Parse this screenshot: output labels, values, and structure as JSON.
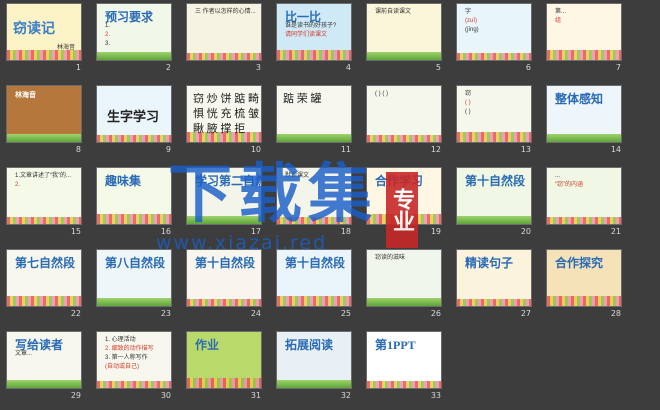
{
  "grid": {
    "background": "#3d3d3d",
    "slides": [
      {
        "n": "1",
        "bg": "#fbf2c6",
        "title": "窃读记",
        "sub": "林海音"
      },
      {
        "n": "2",
        "bg": "#f1f7e9",
        "title": "预习要求",
        "lines": [
          "1.",
          "2.",
          "3."
        ]
      },
      {
        "n": "3",
        "bg": "#f6f3e2",
        "lines": [
          "三 作者以怎样的心情..."
        ]
      },
      {
        "n": "4",
        "bg": "#cfe9f6",
        "title": "比一比",
        "lines": [
          "谁是读书的好孩子?",
          "请同学们读课文"
        ]
      },
      {
        "n": "5",
        "bg": "#fbf6da",
        "lines": [
          "课前自读课文"
        ]
      },
      {
        "n": "6",
        "bg": "#e8f5fb",
        "lines": [
          "字",
          "(zuī)",
          "(jīng)"
        ]
      },
      {
        "n": "7",
        "bg": "#fff7e6",
        "lines": [
          "第...",
          "组"
        ]
      },
      {
        "n": "8",
        "bg": "#b5773c",
        "title": "林海音"
      },
      {
        "n": "9",
        "bg": "#eaf6fb",
        "title": "生字学习"
      },
      {
        "n": "10",
        "bg": "#f7f7ef",
        "lines": [
          "窃 炒 饼 踮 畸",
          "惧 恍 充 梳 皱",
          "瞅 腋 撑 拒"
        ]
      },
      {
        "n": "11",
        "bg": "#f7f7ef",
        "lines": [
          "踮 荣 罐"
        ]
      },
      {
        "n": "12",
        "bg": "#f5f7ec",
        "lines": [
          "( ) ( )"
        ]
      },
      {
        "n": "13",
        "bg": "#f5f7ec",
        "lines": [
          "窃",
          "( )",
          "( )"
        ]
      },
      {
        "n": "14",
        "bg": "#eef5fb",
        "title": "整体感知"
      },
      {
        "n": "15",
        "bg": "#f4f9e8",
        "lines": [
          "1.文章讲述了“我”的...",
          "2."
        ]
      },
      {
        "n": "16",
        "bg": "#f4f9e8",
        "title": "趣味集"
      },
      {
        "n": "17",
        "bg": "#f3f5ea",
        "title": "学习第二自然段"
      },
      {
        "n": "18",
        "bg": "#f3f5ea",
        "lines": [
          "默读课文"
        ]
      },
      {
        "n": "19",
        "bg": "#fff6e3",
        "title": "合作学习"
      },
      {
        "n": "20",
        "bg": "#f0f7e5",
        "title": "第十自然段"
      },
      {
        "n": "21",
        "bg": "#f0f7e5",
        "lines": [
          "...",
          "“窃”的内涵"
        ]
      },
      {
        "n": "22",
        "bg": "#f7f7ef",
        "title": "第七自然段"
      },
      {
        "n": "23",
        "bg": "#eef6f8",
        "title": "第八自然段"
      },
      {
        "n": "24",
        "bg": "#f7f5ee",
        "title": "第十自然段"
      },
      {
        "n": "25",
        "bg": "#eaf4fb",
        "title": "第十自然段"
      },
      {
        "n": "26",
        "bg": "#f1f6ec",
        "lines": [
          "窃读的滋味"
        ]
      },
      {
        "n": "27",
        "bg": "#fbf3dc",
        "title": "精读句子"
      },
      {
        "n": "28",
        "bg": "#f5e2b8",
        "title": "合作探究"
      },
      {
        "n": "29",
        "bg": "#f7f7ef",
        "title": "写给读者",
        "lines": [
          "文章..."
        ]
      },
      {
        "n": "30",
        "bg": "#f7f7ef",
        "lines": [
          "1. 心理活动",
          "2. 细致的动作描写",
          "3. 第一人称写作",
          "(自动或自己)"
        ]
      },
      {
        "n": "31",
        "bg": "#b9d96a",
        "title": "作业"
      },
      {
        "n": "32",
        "bg": "#e9f0f5",
        "title": "拓展阅读"
      },
      {
        "n": "33",
        "bg": "#ffffff",
        "title": "第1PPT"
      }
    ]
  },
  "watermark": {
    "title": "下载集",
    "url": "www.xiazai.red",
    "seal": "专业"
  },
  "colors": {
    "accent_blue": "#1a5fc8",
    "seal_red": "#c62828"
  }
}
